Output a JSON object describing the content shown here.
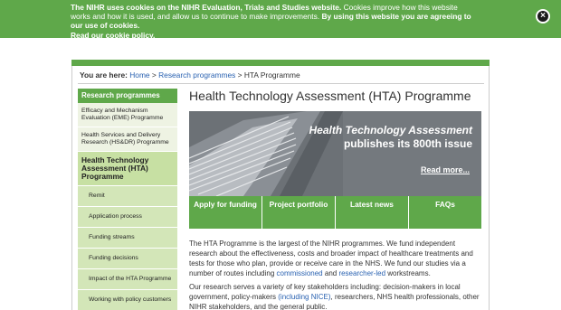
{
  "cookie": {
    "text_bold_1": "The NIHR uses cookies on the NIHR Evaluation, Trials and Studies website.",
    "text_1": " Cookies improve how this website works and how it is used, and allow us to continue to make improvements.",
    "text_bold_2": " By using this website you are agreeing to our use of cookies.",
    "link": "Read our cookie policy.",
    "close": "×"
  },
  "breadcrumb": {
    "label": "You are here:",
    "home": "Home",
    "sep1": " > ",
    "research": "Research programmes",
    "sep2": " > ",
    "current": "HTA Programme"
  },
  "sidebar": {
    "heading": "Research programmes",
    "items": [
      "Efficacy and Mechanism Evaluation (EME) Programme",
      "Health Services and Delivery Research (HS&DR) Programme",
      "Health Technology Assessment (HTA) Programme"
    ],
    "subitems": [
      "Remit",
      "Application process",
      "Funding streams",
      "Funding decisions",
      "Impact of the HTA Programme",
      "Working with policy customers"
    ]
  },
  "main": {
    "title": "Health Technology Assessment (HTA) Programme",
    "banner_title": "Health Technology Assessment",
    "banner_sub": "publishes its 800th issue",
    "banner_more": "Read more...",
    "tabs": [
      "Apply for funding",
      "Project portfolio",
      "Latest news",
      "FAQs"
    ],
    "p1_a": "The HTA Programme is the largest of the NIHR programmes. We fund independent research about the effectiveness, costs and broader impact of healthcare treatments and tests for those who plan, provide or receive care in the NHS. We fund our studies via a number of routes including ",
    "p1_link1": "commissioned",
    "p1_b": " and ",
    "p1_link2": "researcher-led",
    "p1_c": " workstreams.",
    "p2_a": "Our research serves a variety of key stakeholders including: decision-makers in local government, policy-makers ",
    "p2_link": "(including NICE)",
    "p2_b": ", researchers, NHS health professionals, other NIHR stakeholders, and the general public."
  },
  "colors": {
    "accent": "#5fa84a",
    "link": "#2a62b1",
    "sidebar_light": "#eef3e3",
    "sidebar_sub": "#d3e6b8"
  }
}
